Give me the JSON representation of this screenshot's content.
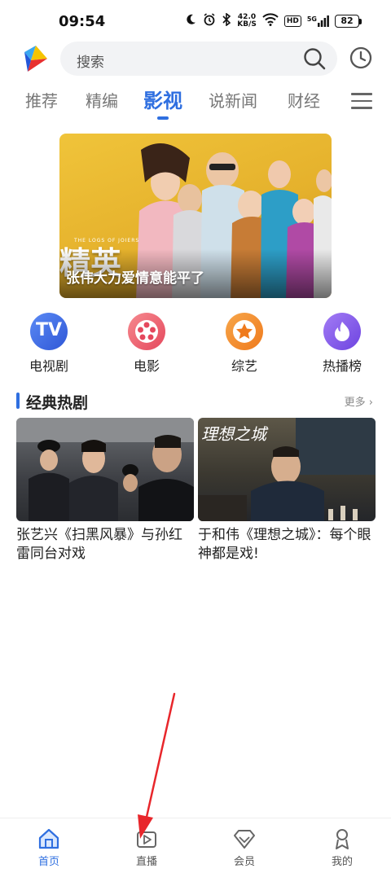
{
  "status_bar": {
    "time": "09:54",
    "net_speed_value": "42.0",
    "net_speed_unit": "KB/S",
    "hd": "HD",
    "signal": "5G",
    "battery": "82"
  },
  "header": {
    "search_placeholder": "搜索"
  },
  "tabs": [
    {
      "label": "推荐",
      "active": false
    },
    {
      "label": "精编",
      "active": false
    },
    {
      "label": "影视",
      "active": true
    },
    {
      "label": "说新闻",
      "active": false
    },
    {
      "label": "财经",
      "active": false
    }
  ],
  "banner": {
    "caption": "张伟大力爱情意能平了",
    "poster_text": "精英",
    "poster_subtext": "THE LOGS OF JOIERS"
  },
  "categories": [
    {
      "label": "电视剧",
      "icon": "tv-icon",
      "color": "#3f66e0"
    },
    {
      "label": "电影",
      "icon": "film-reel-icon",
      "color": "#ec5b6b"
    },
    {
      "label": "综艺",
      "icon": "star-icon",
      "color": "#f28a2b"
    },
    {
      "label": "热播榜",
      "icon": "flame-icon",
      "color": "#8056e8"
    }
  ],
  "section": {
    "title": "经典热剧",
    "more": "更多"
  },
  "cards": [
    {
      "title": "张艺兴《扫黑风暴》与孙红雷同台对戏"
    },
    {
      "title": "于和伟《理想之城》：每个眼神都是戏!",
      "poster_text": "理想之城"
    }
  ],
  "bottom_nav": [
    {
      "label": "首页",
      "icon": "home-icon",
      "active": true
    },
    {
      "label": "直播",
      "icon": "live-play-icon",
      "active": false
    },
    {
      "label": "会员",
      "icon": "diamond-icon",
      "active": false
    },
    {
      "label": "我的",
      "icon": "profile-icon",
      "active": false
    }
  ],
  "colors": {
    "accent": "#2f6fe0",
    "annotation_arrow": "#e8262b"
  }
}
